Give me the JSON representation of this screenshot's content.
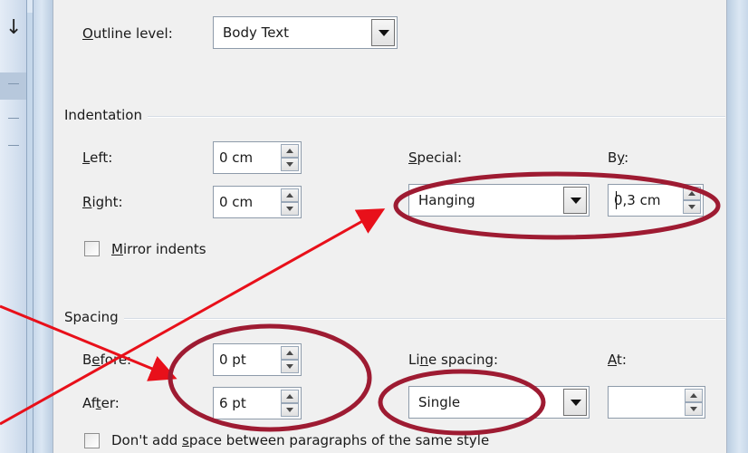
{
  "outline": {
    "label_prefix": "O",
    "label_rest": "utline level:",
    "value": "Body Text"
  },
  "indentation": {
    "title": "Indentation",
    "left": {
      "label_prefix": "L",
      "label_rest": "eft:",
      "value": "0 cm"
    },
    "right": {
      "label_prefix": "R",
      "label_rest": "ight:",
      "value": "0 cm"
    },
    "special": {
      "label_prefix": "S",
      "label_rest": "pecial:",
      "value": "Hanging"
    },
    "by": {
      "label_prefix": "B",
      "label_mid": "y",
      "label_rest": ":",
      "value": "0,3 cm"
    },
    "mirror": {
      "label_prefix": "M",
      "label_rest": "irror indents"
    }
  },
  "spacing": {
    "title": "Spacing",
    "before": {
      "label_prefix": "B",
      "label_mid": "e",
      "label_rest": "fore:",
      "value": "0 pt"
    },
    "after": {
      "label_prefix": "Af",
      "label_mid": "t",
      "label_rest": "er:",
      "value": "6 pt"
    },
    "line_spacing": {
      "label_prefix": "Li",
      "label_mid": "n",
      "label_rest": "e spacing:",
      "value": "Single"
    },
    "at": {
      "label_prefix": "A",
      "label_rest": "t:",
      "value": ""
    },
    "dont_add": {
      "label_prefix": "Don't add ",
      "label_mid": "s",
      "label_rest": "pace between paragraphs of the same style"
    }
  },
  "colors": {
    "annotation_ellipse": "#9e1b32",
    "annotation_arrow": "#e8101a"
  }
}
